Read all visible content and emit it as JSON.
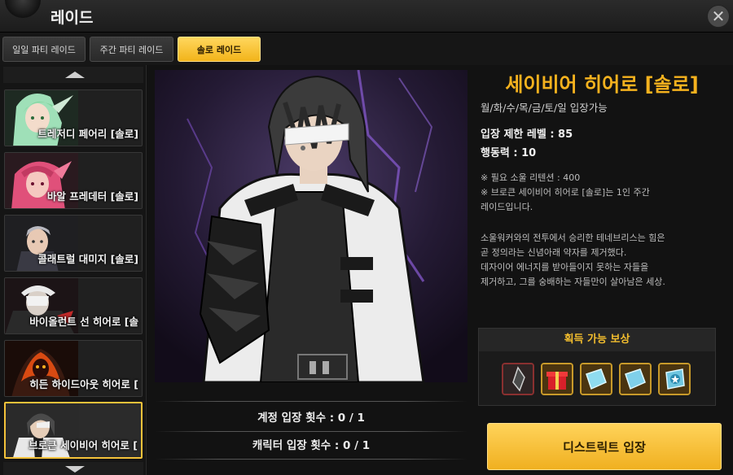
{
  "window": {
    "title": "레이드",
    "close_icon": "close-icon"
  },
  "tabs": [
    {
      "label": "일일 파티 레이드",
      "active": false
    },
    {
      "label": "주간 파티 레이드",
      "active": false
    },
    {
      "label": "솔로 레이드",
      "active": true
    }
  ],
  "raid_list": [
    {
      "name": "트레저디 페어리 [솔로]",
      "selected": false,
      "portrait_icon": "green-haired-fairy-portrait"
    },
    {
      "name": "바알 프레데터 [솔로]",
      "selected": false,
      "portrait_icon": "pink-haired-predator-portrait"
    },
    {
      "name": "콜래트럴 대미지 [솔로]",
      "selected": false,
      "portrait_icon": "grey-haired-man-portrait"
    },
    {
      "name": "바이올런트 선 히어로 [솔",
      "selected": false,
      "portrait_icon": "masked-hero-portrait"
    },
    {
      "name": "히든 하이드아웃 히어로 [",
      "selected": false,
      "portrait_icon": "fiery-demon-portrait"
    },
    {
      "name": "브로큰 세이비어 히어로 [",
      "selected": true,
      "portrait_icon": "eyepatch-hero-portrait"
    }
  ],
  "entry_counts": {
    "account": "계정 입장 횟수 : 0 / 1",
    "character": "캐릭터 입장 횟수 : 0 / 1"
  },
  "detail": {
    "title": "세이비어 히어로 [솔로]",
    "days": "월/화/수/목/금/토/일 입장가능",
    "level_limit": "입장 제한 레벨 : 85",
    "action_points": "행동력 : 10",
    "notes": [
      "※ 필요 소울 리텐션 : 400",
      "※ 브로큰 세이비어 히어로 [솔로]는 1인 주간",
      "레이드입니다."
    ],
    "lore": [
      "소울워커와의 전투에서 승리한 테네브리스는 힘은",
      "곧 정의라는 신념아래 약자를 제거했다.",
      "데자이어 에너지를 받아들이지 못하는 자들을",
      "제거하고, 그를 숭배하는 자들만이 살아남은 세상."
    ]
  },
  "rewards": {
    "header": "획득 가능 보상",
    "items": [
      {
        "icon": "dark-crystal-shard-icon"
      },
      {
        "icon": "red-gift-box-icon"
      },
      {
        "icon": "blue-crystal-ticket-icon"
      },
      {
        "icon": "blue-crystal-ticket-icon"
      },
      {
        "icon": "star-medal-icon"
      }
    ]
  },
  "enter_button": {
    "label": "디스트릭트 입장"
  },
  "colors": {
    "accent": "#f5b21e",
    "button_gold": "#f0b020",
    "background": "#151515"
  }
}
